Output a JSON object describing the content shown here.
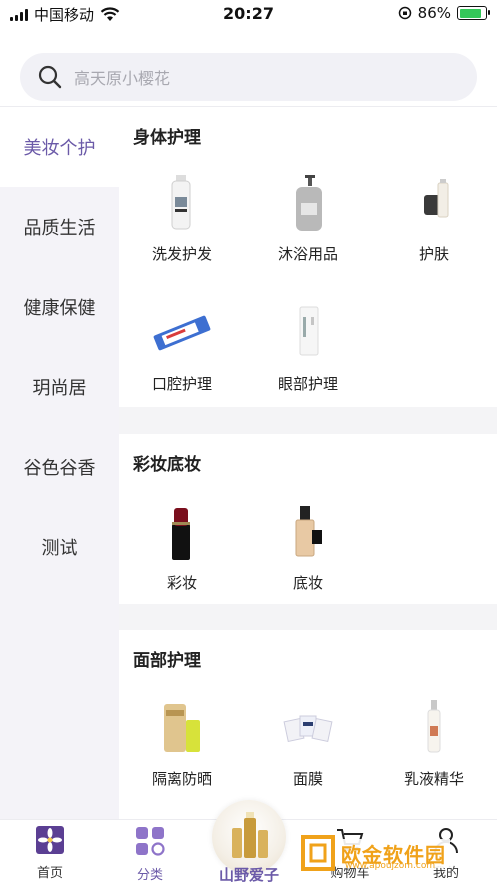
{
  "status_bar": {
    "carrier": "中国移动",
    "time": "20:27",
    "battery": "86%"
  },
  "search": {
    "placeholder": "高天原小樱花"
  },
  "sidebar": {
    "items": [
      {
        "label": "美妆个护"
      },
      {
        "label": "品质生活"
      },
      {
        "label": "健康保健"
      },
      {
        "label": "玥尚居"
      },
      {
        "label": "谷色谷香"
      },
      {
        "label": "测试"
      }
    ]
  },
  "sections": [
    {
      "title": "身体护理",
      "items": [
        {
          "label": "洗发护发",
          "icon": "shampoo-bottle-icon"
        },
        {
          "label": "沐浴用品",
          "icon": "body-wash-pump-icon"
        },
        {
          "label": "护肤",
          "icon": "skincare-bottle-icon"
        },
        {
          "label": "口腔护理",
          "icon": "toothpaste-icon"
        },
        {
          "label": "眼部护理",
          "icon": "eye-cream-tube-icon"
        }
      ]
    },
    {
      "title": "彩妆底妆",
      "items": [
        {
          "label": "彩妆",
          "icon": "lipstick-icon"
        },
        {
          "label": "底妆",
          "icon": "foundation-bottle-icon"
        }
      ]
    },
    {
      "title": "面部护理",
      "items": [
        {
          "label": "隔离防晒",
          "icon": "sunscreen-icon"
        },
        {
          "label": "面膜",
          "icon": "face-mask-sheets-icon"
        },
        {
          "label": "乳液精华",
          "icon": "serum-bottle-icon"
        }
      ]
    }
  ],
  "bottom_nav": {
    "home": "首页",
    "category": "分类",
    "brand": "山野爱子",
    "cart": "购物车",
    "mine": "我的"
  },
  "watermark": {
    "text": "欧金软件园",
    "url": "www.apoujzom.com"
  },
  "colors": {
    "accent": "#6b5aa8",
    "sidebar_bg": "#f4f3f8",
    "watermark": "#f0a21a"
  }
}
